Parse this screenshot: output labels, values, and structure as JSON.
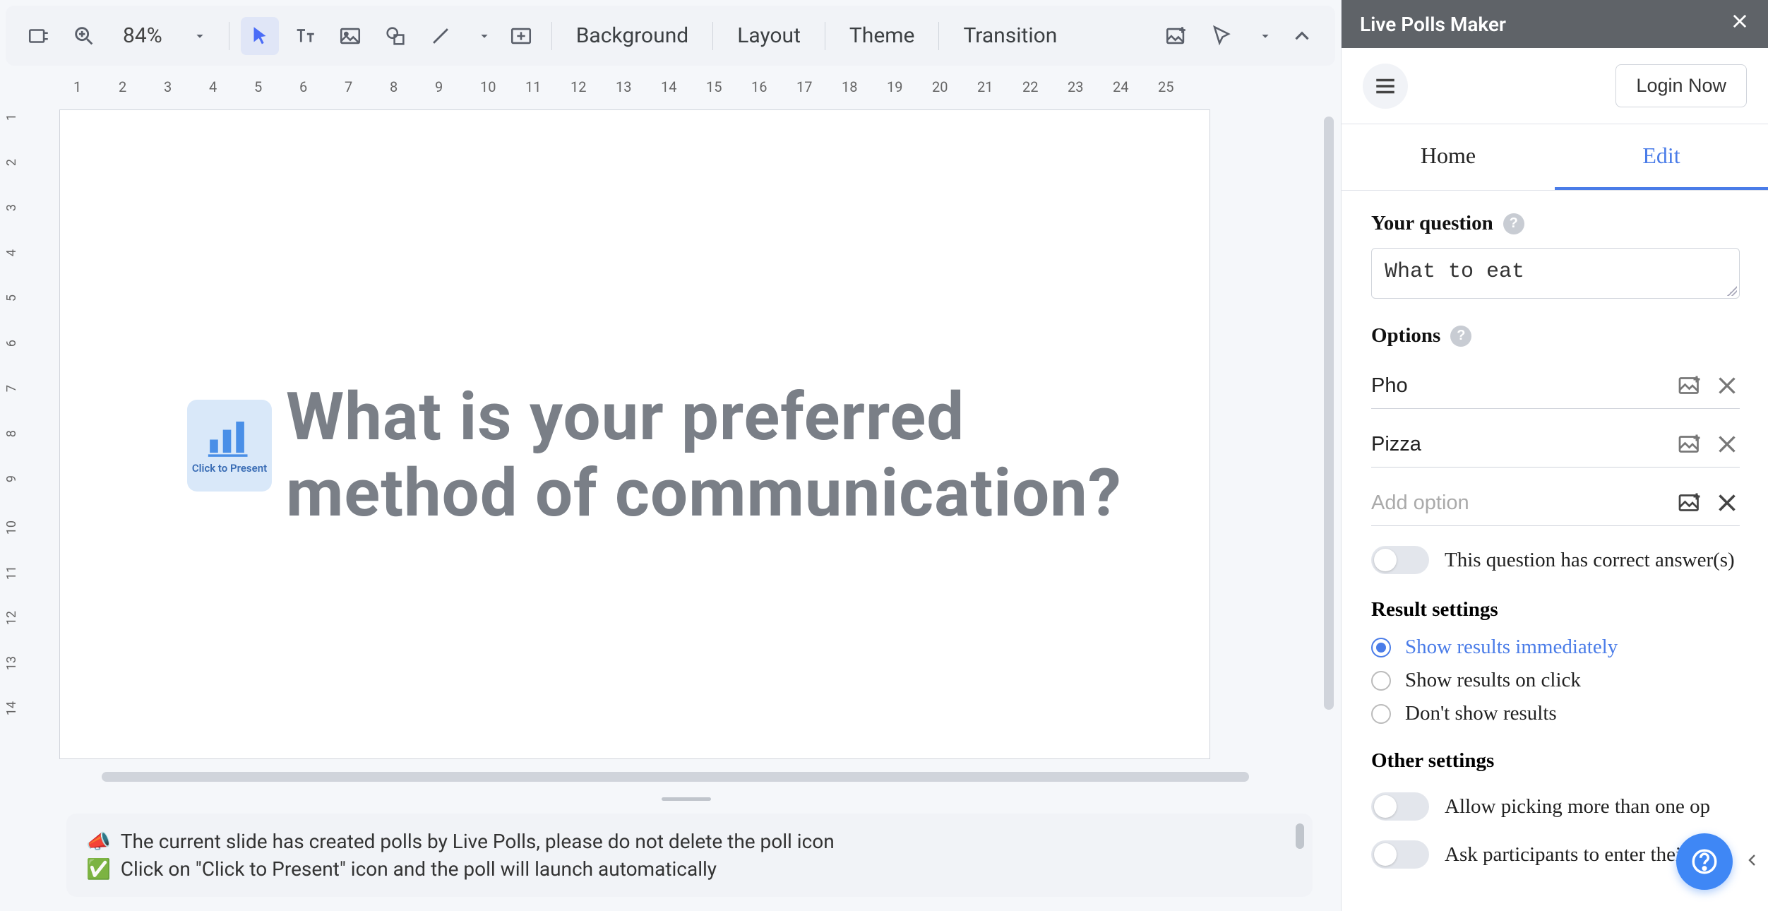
{
  "toolbar": {
    "zoom": "84%",
    "background": "Background",
    "layout": "Layout",
    "theme": "Theme",
    "transition": "Transition"
  },
  "ruler_h": [
    "1",
    "2",
    "3",
    "4",
    "5",
    "6",
    "7",
    "8",
    "9",
    "10",
    "11",
    "12",
    "13",
    "14",
    "15",
    "16",
    "17",
    "18",
    "19",
    "20",
    "21",
    "22",
    "23",
    "24",
    "25"
  ],
  "ruler_v": [
    "1",
    "2",
    "3",
    "4",
    "5",
    "6",
    "7",
    "8",
    "9",
    "10",
    "11",
    "12",
    "13",
    "14"
  ],
  "slide": {
    "poll_icon_label": "Click to Present",
    "question": "What is your preferred method of communication?"
  },
  "notice": {
    "line1_emoji": "📣",
    "line1": "The current slide has created polls by Live Polls, please do not delete the poll icon",
    "line2_emoji": "✅",
    "line2": "Click on \"Click to Present\" icon and the poll will launch automatically"
  },
  "sidebar": {
    "title": "Live Polls Maker",
    "login_btn": "Login Now",
    "tabs": {
      "home": "Home",
      "edit": "Edit"
    },
    "your_question_label": "Your question",
    "question_value": "What to eat",
    "options_label": "Options",
    "options": [
      "Pho",
      "Pizza"
    ],
    "add_option_placeholder": "Add option",
    "correct_answer_toggle": "This question has correct answer(s)",
    "result_settings_title": "Result settings",
    "result_options": {
      "immediately": "Show results immediately",
      "on_click": "Show results on click",
      "dont_show": "Don't show results"
    },
    "other_settings_title": "Other settings",
    "other_toggle1": "Allow picking more than one op",
    "other_toggle2": "Ask participants to enter their na"
  }
}
